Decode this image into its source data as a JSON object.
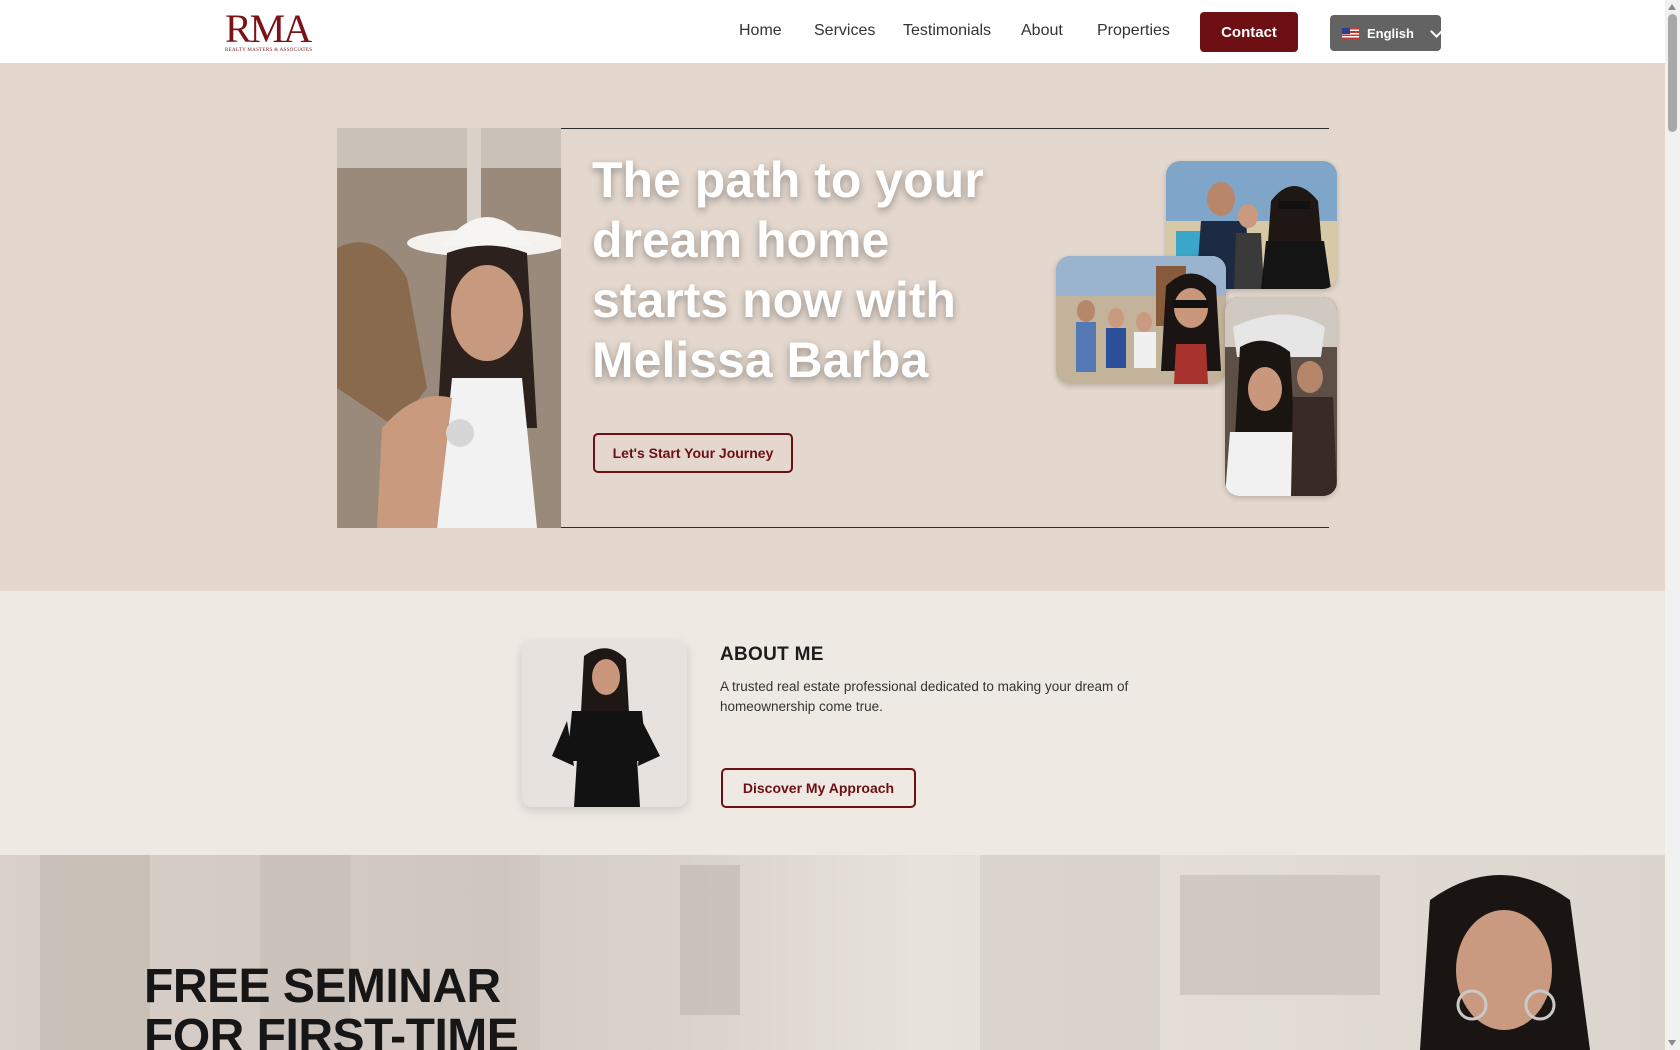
{
  "header": {
    "logo_text": "RMA",
    "logo_subtitle": "REALTY MASTERS & ASSOCIATES",
    "nav": [
      {
        "label": "Home"
      },
      {
        "label": "Services"
      },
      {
        "label": "Testimonials"
      },
      {
        "label": "About"
      },
      {
        "label": "Properties"
      }
    ],
    "contact_label": "Contact",
    "language_label": "English"
  },
  "hero": {
    "title_light": "The path to your dream home starts now with ",
    "title_bold": "Melissa Barba",
    "cta_label": "Let's Start Your Journey"
  },
  "about": {
    "heading": "ABOUT ME",
    "text": "A trusted real estate professional dedicated to making your dream of homeownership come true.",
    "cta_label": "Discover My Approach"
  },
  "seminar": {
    "title_line1": "FREE SEMINAR",
    "title_line2": "FOR FIRST-TIME"
  },
  "colors": {
    "brand": "#6e0f14",
    "hero_bg": "#e4d8ce",
    "page_bg": "#efe9e3"
  }
}
